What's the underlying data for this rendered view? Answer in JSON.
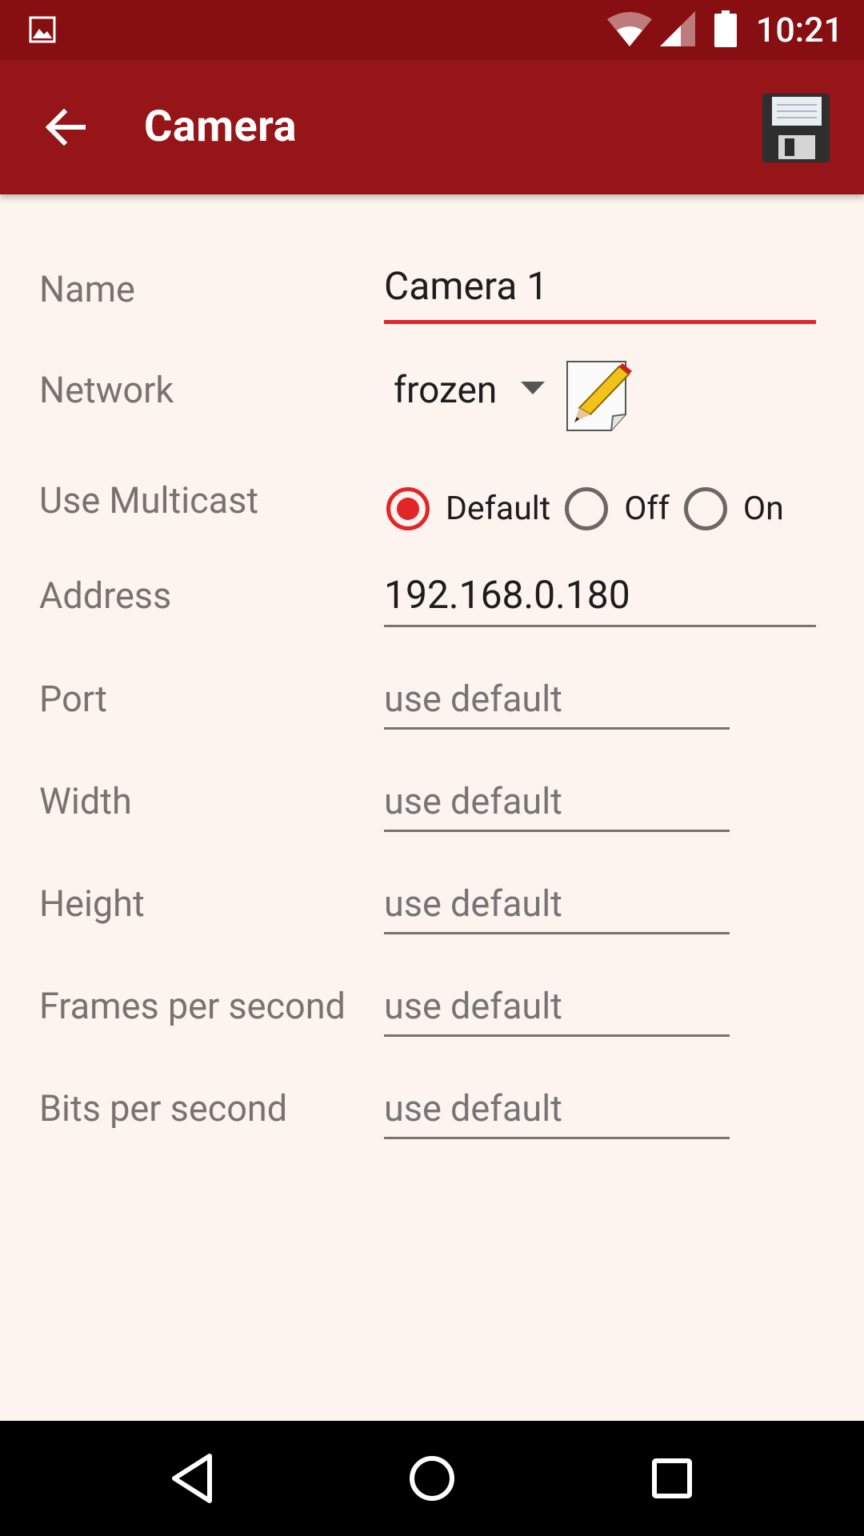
{
  "status_bar": {
    "time": "10:21",
    "icons": [
      "image-icon",
      "wifi-icon",
      "cell-signal-icon",
      "battery-icon"
    ]
  },
  "app_bar": {
    "title": "Camera",
    "back_icon": "arrow-left-icon",
    "save_icon": "floppy-disk-icon"
  },
  "form": {
    "name": {
      "label": "Name",
      "value": "Camera 1"
    },
    "network": {
      "label": "Network",
      "selected": "frozen",
      "edit_icon": "pencil-edit-icon"
    },
    "multicast": {
      "label": "Use Multicast",
      "options": [
        "Default",
        "Off",
        "On"
      ],
      "selected": "Default"
    },
    "address": {
      "label": "Address",
      "value": "192.168.0.180"
    },
    "port": {
      "label": "Port",
      "placeholder": "use default"
    },
    "width": {
      "label": "Width",
      "placeholder": "use default"
    },
    "height": {
      "label": "Height",
      "placeholder": "use default"
    },
    "fps": {
      "label": "Frames per second",
      "placeholder": "use default"
    },
    "bps": {
      "label": "Bits per second",
      "placeholder": "use default"
    }
  },
  "nav_bar": {
    "icons": [
      "back-triangle-icon",
      "home-circle-icon",
      "recents-square-icon"
    ]
  },
  "colors": {
    "status_bar": "#870f12",
    "app_bar": "#961518",
    "accent": "#e12628",
    "background": "#fdf3ef"
  }
}
